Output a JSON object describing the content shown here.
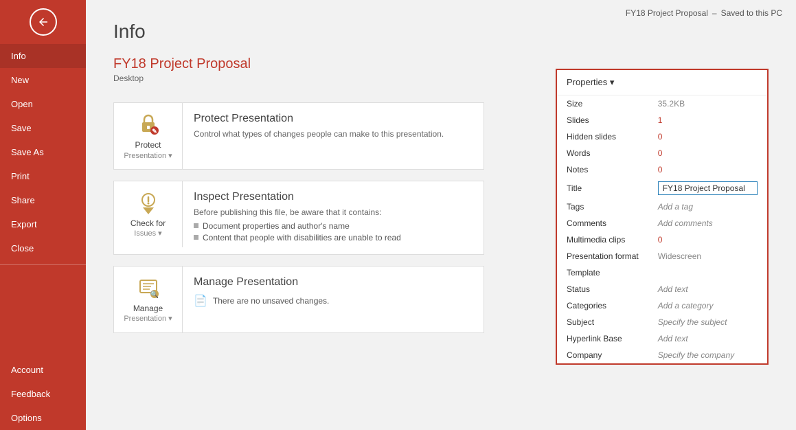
{
  "topbar": {
    "filename": "FY18 Project Proposal",
    "separator": "–",
    "saved_status": "Saved to this PC"
  },
  "sidebar": {
    "back_icon": "←",
    "items": [
      {
        "label": "Info",
        "active": true
      },
      {
        "label": "New",
        "active": false
      },
      {
        "label": "Open",
        "active": false
      },
      {
        "label": "Save",
        "active": false
      },
      {
        "label": "Save As",
        "active": false
      },
      {
        "label": "Print",
        "active": false
      },
      {
        "label": "Share",
        "active": false
      },
      {
        "label": "Export",
        "active": false
      },
      {
        "label": "Close",
        "active": false
      }
    ],
    "bottom_items": [
      {
        "label": "Account"
      },
      {
        "label": "Feedback"
      },
      {
        "label": "Options"
      }
    ]
  },
  "page": {
    "title": "Info",
    "file_name": "FY18 Project Proposal",
    "file_location": "Desktop"
  },
  "sections": [
    {
      "id": "protect",
      "icon_label": "Protect",
      "icon_sublabel": "Presentation ▾",
      "heading": "Protect Presentation",
      "description": "Control what types of changes people can make to this presentation.",
      "type": "desc"
    },
    {
      "id": "check",
      "icon_label": "Check for",
      "icon_sublabel": "Issues ▾",
      "heading": "Inspect Presentation",
      "description": "Before publishing this file, be aware that it contains:",
      "type": "bullets",
      "bullets": [
        "Document properties and author's name",
        "Content that people with disabilities are unable to read"
      ]
    },
    {
      "id": "manage",
      "icon_label": "Manage",
      "icon_sublabel": "Presentation ▾",
      "heading": "Manage Presentation",
      "note": "There are no unsaved changes.",
      "type": "note"
    }
  ],
  "properties": {
    "header": "Properties ▾",
    "rows": [
      {
        "label": "Size",
        "value": "35.2KB",
        "type": "normal"
      },
      {
        "label": "Slides",
        "value": "1",
        "type": "orange"
      },
      {
        "label": "Hidden slides",
        "value": "0",
        "type": "orange"
      },
      {
        "label": "Words",
        "value": "0",
        "type": "orange"
      },
      {
        "label": "Notes",
        "value": "0",
        "type": "orange"
      },
      {
        "label": "Title",
        "value": "FY18 Project Proposal",
        "type": "input"
      },
      {
        "label": "Tags",
        "value": "Add a tag",
        "type": "add"
      },
      {
        "label": "Comments",
        "value": "Add comments",
        "type": "add"
      },
      {
        "label": "Multimedia clips",
        "value": "0",
        "type": "orange"
      },
      {
        "label": "Presentation format",
        "value": "Widescreen",
        "type": "normal"
      },
      {
        "label": "Template",
        "value": "",
        "type": "normal"
      },
      {
        "label": "Status",
        "value": "Add text",
        "type": "add"
      },
      {
        "label": "Categories",
        "value": "Add a category",
        "type": "add"
      },
      {
        "label": "Subject",
        "value": "Specify the subject",
        "type": "add"
      },
      {
        "label": "Hyperlink Base",
        "value": "Add text",
        "type": "add"
      },
      {
        "label": "Company",
        "value": "Specify the company",
        "type": "add"
      }
    ]
  }
}
